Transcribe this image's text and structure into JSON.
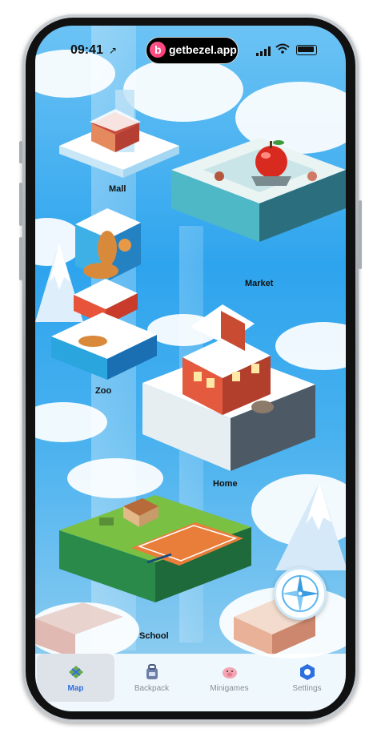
{
  "status_bar": {
    "time": "09:41",
    "dynamic_island_text": "getbezel.app",
    "island_logo_letter": "b"
  },
  "map": {
    "locations": [
      {
        "id": "mall",
        "label": "Mall"
      },
      {
        "id": "market",
        "label": "Market"
      },
      {
        "id": "zoo",
        "label": "Zoo"
      },
      {
        "id": "home",
        "label": "Home"
      },
      {
        "id": "school",
        "label": "School"
      }
    ],
    "compass_icon": "compass-icon"
  },
  "tabbar": {
    "tabs": [
      {
        "label": "Map",
        "icon": "map-icon",
        "active": true
      },
      {
        "label": "Backpack",
        "icon": "backpack-icon",
        "active": false
      },
      {
        "label": "Minigames",
        "icon": "pig-icon",
        "active": false
      },
      {
        "label": "Settings",
        "icon": "settings-icon",
        "active": false
      }
    ]
  },
  "colors": {
    "accent": "#2d6fde",
    "sky": "#2ea4ee"
  }
}
